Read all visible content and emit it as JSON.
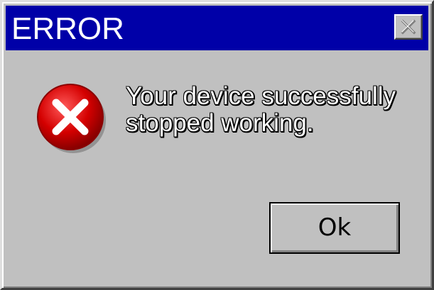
{
  "dialog": {
    "title": "ERROR",
    "message_lines": [
      "Your device successfully",
      "stopped working."
    ],
    "ok_label": "Ok",
    "icon": "error-icon",
    "close_icon": "close-icon"
  },
  "colors": {
    "titlebar": "#0000a8",
    "window": "#c0c0c0",
    "icon_red": "#d40000",
    "text": "#ffffff"
  }
}
